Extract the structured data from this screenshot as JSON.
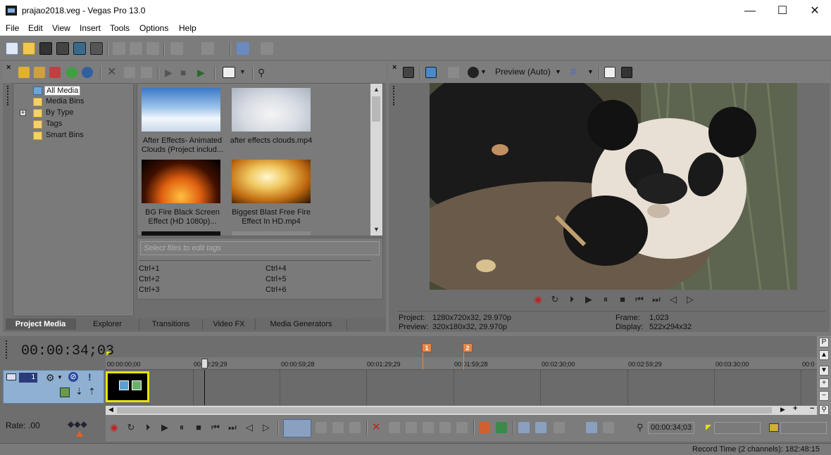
{
  "window": {
    "title": "prajao2018.veg - Vegas Pro 13.0",
    "minimize": "—",
    "maximize": "☐",
    "close": "✕"
  },
  "menu": [
    "File",
    "Edit",
    "View",
    "Insert",
    "Tools",
    "Options",
    "Help"
  ],
  "explorer": {
    "tree": [
      {
        "label": "All Media",
        "selected": true
      },
      {
        "label": "Media Bins"
      },
      {
        "label": "By Type",
        "expandable": true
      },
      {
        "label": "Tags"
      },
      {
        "label": "Smart Bins"
      }
    ],
    "media": [
      {
        "caption1": "After Effects- Animated",
        "caption2": "Clouds (Project includ..."
      },
      {
        "caption1": "after effects clouds.mp4",
        "caption2": ""
      },
      {
        "caption1": "BG Fire Black Screen",
        "caption2": "Effect (HD 1080p)..."
      },
      {
        "caption1": "Biggest Blast Free Fire",
        "caption2": "Effect In HD.mp4"
      }
    ],
    "tags_placeholder": "Select files to edit tags",
    "shortcuts": [
      "Ctrl+1",
      "Ctrl+2",
      "Ctrl+3",
      "Ctrl+4",
      "Ctrl+5",
      "Ctrl+6"
    ],
    "tabs": [
      "Project Media",
      "Explorer",
      "Transitions",
      "Video FX",
      "Media Generators"
    ]
  },
  "preview": {
    "mode_label": "Preview (Auto)",
    "project_label": "Project:",
    "project_value": "1280x720x32, 29.970p",
    "preview_label": "Preview:",
    "preview_value": "320x180x32, 29.970p",
    "frame_label": "Frame:",
    "frame_value": "1,023",
    "display_label": "Display:",
    "display_value": "522x294x32"
  },
  "timeline": {
    "time": "00:00:34;03",
    "ticks": [
      "00:00:00;00",
      "00:00:29;29",
      "00:00:59;28",
      "00:01:29;29",
      "00:01:59;28",
      "00:02:30;00",
      "00:02:59;29",
      "00:03:30;00",
      "00:0"
    ],
    "markers": [
      "1",
      "2"
    ],
    "track_number": "1",
    "rate_label": "Rate: .00",
    "cursor_time": "00:00:34;03"
  },
  "status": {
    "record_time": "Record Time (2 channels): 182:48:15"
  }
}
